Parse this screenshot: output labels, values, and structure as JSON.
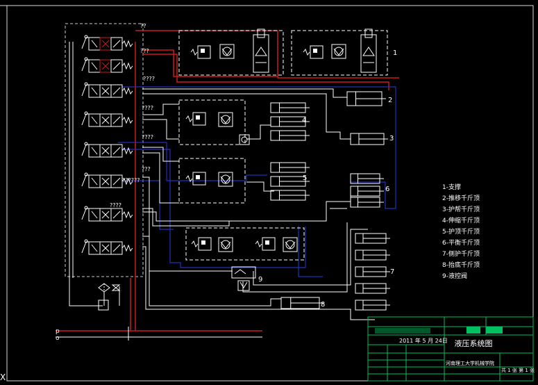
{
  "colors": {
    "background": "#000000",
    "line": "#ffffff",
    "pressure": "#cc1a1a",
    "return": "#2233bb",
    "title_block": "#00c060",
    "label": "#ffdd00"
  },
  "callouts": [
    "1",
    "2",
    "3",
    "4",
    "5",
    "6",
    "7",
    "8",
    "9"
  ],
  "valve_marks": [
    "??",
    "???",
    "????",
    "????",
    "????",
    "???",
    "??????",
    "????",
    "??"
  ],
  "port_labels": {
    "p": "p",
    "o": "o"
  },
  "corner_mark": "X",
  "legend": [
    "1-支撑",
    "2-推移千斤顶",
    "3-护帮千斤顶",
    "4-伸缩千斤顶",
    "5-护顶千斤顶",
    "6-平衡千斤顶",
    "7-侧护千斤顶",
    "8-抬底千斤顶",
    "9-液控阀"
  ],
  "title_block": {
    "drawing_title": "液压系统图",
    "date": "2011 年 5 月 24日",
    "school": "河南理工大学机械学院",
    "scale_sheet": "共 1 张  第 1 张"
  }
}
